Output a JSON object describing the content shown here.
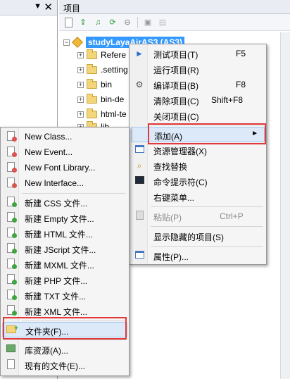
{
  "left_pane": {
    "dropdown_glyph": "▼",
    "close_glyph": "✕"
  },
  "project_panel": {
    "title": "项目",
    "toolbar_icons": [
      "new-file-icon",
      "open-icon",
      "publish-icon",
      "refresh-icon",
      "stop-icon",
      "settings-icon",
      "disabled-icon"
    ]
  },
  "tree": {
    "root": {
      "label": "studyLayaAirAS3 (AS3)",
      "expander": "−"
    },
    "children": [
      {
        "label": "Refere",
        "expander": "+"
      },
      {
        "label": ".setting",
        "expander": "+"
      },
      {
        "label": "bin",
        "expander": "+"
      },
      {
        "label": "bin-de",
        "expander": "+"
      },
      {
        "label": "html-te",
        "expander": "+"
      },
      {
        "label": "lib",
        "expander": "+"
      }
    ]
  },
  "context_menu": {
    "items": [
      {
        "label": "测试项目(T)",
        "shortcut": "F5",
        "icon": "play-icon"
      },
      {
        "label": "运行项目(R)",
        "shortcut": "",
        "icon": ""
      },
      {
        "label": "编译项目(B)",
        "shortcut": "F8",
        "icon": "gear-icon"
      },
      {
        "label": "清除项目(C)",
        "shortcut": "Shift+F8",
        "icon": ""
      },
      {
        "label": "关闭项目(C)",
        "shortcut": "",
        "icon": ""
      },
      {
        "label": "添加(A)",
        "shortcut": "",
        "icon": "",
        "submenu_arrow": "►"
      },
      {
        "label": "资源管理器(X)",
        "shortcut": "",
        "icon": "explorer-icon"
      },
      {
        "label": "查找替换",
        "shortcut": "",
        "icon": "find-icon"
      },
      {
        "label": "命令提示符(C)",
        "shortcut": "",
        "icon": "terminal-icon"
      },
      {
        "label": "右键菜单...",
        "shortcut": "",
        "icon": ""
      },
      {
        "label": "粘贴(P)",
        "shortcut": "Ctrl+P",
        "icon": "paste-icon",
        "disabled": true
      },
      {
        "label": "显示隐藏的项目(S)",
        "shortcut": "",
        "icon": ""
      },
      {
        "label": "属性(P)...",
        "shortcut": "",
        "icon": "properties-icon"
      }
    ]
  },
  "submenu": {
    "items": [
      {
        "label": "New Class..."
      },
      {
        "label": "New Event..."
      },
      {
        "label": "New Font Library..."
      },
      {
        "label": "New Interface..."
      },
      {
        "label": "新建 CSS 文件..."
      },
      {
        "label": "新建 Empty 文件..."
      },
      {
        "label": "新建 HTML 文件..."
      },
      {
        "label": "新建 JScript 文件..."
      },
      {
        "label": "新建 MXML 文件..."
      },
      {
        "label": "新建 PHP 文件..."
      },
      {
        "label": "新建 TXT 文件..."
      },
      {
        "label": "新建 XML 文件..."
      },
      {
        "label": "文件夹(F)..."
      },
      {
        "label": "库资源(A)..."
      },
      {
        "label": "现有的文件(E)..."
      }
    ]
  },
  "colors": {
    "selection": "#3399ff",
    "highlight_box": "#e23a3a",
    "menu_hover": "#dbe9f8"
  }
}
